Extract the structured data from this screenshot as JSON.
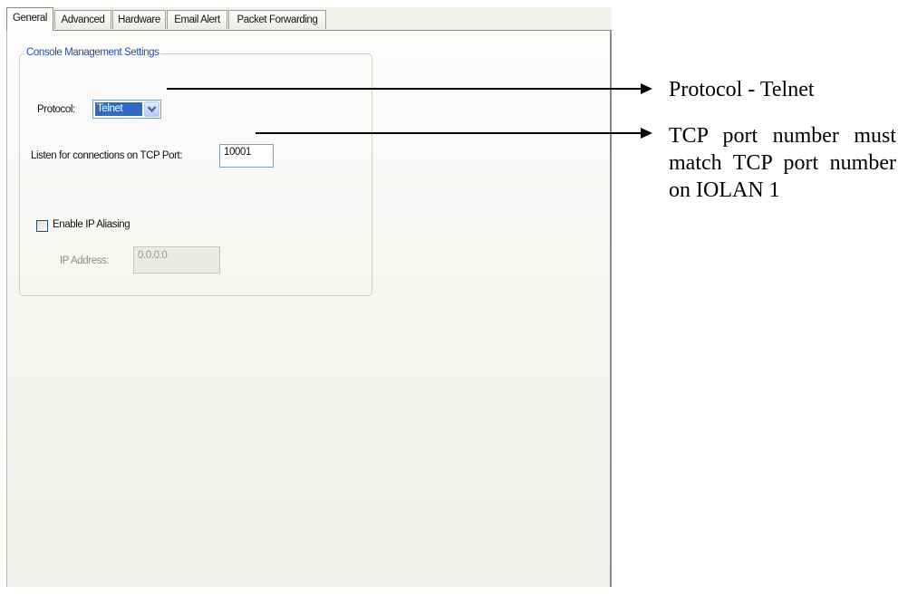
{
  "tabs": [
    {
      "label": "General",
      "active": true
    },
    {
      "label": "Advanced",
      "active": false
    },
    {
      "label": "Hardware",
      "active": false
    },
    {
      "label": "Email Alert",
      "active": false
    },
    {
      "label": "Packet Forwarding",
      "active": false
    }
  ],
  "group": {
    "title": "Console Management Settings",
    "protocol_label": "Protocol:",
    "protocol_value": "Telnet",
    "port_label": "Listen for connections on TCP Port:",
    "port_value": "10001",
    "ip_aliasing_label": "Enable IP Aliasing",
    "ip_aliasing_checked": false,
    "ip_address_label": "IP Address:",
    "ip_address_value": "0.0.0.0"
  },
  "annotations": {
    "protocol_note": "Protocol - Telnet",
    "port_note": "TCP port number must match TCP port number on IOLAN 1"
  },
  "colors": {
    "group_title": "#1d4eb5",
    "selection": "#316ac5"
  }
}
